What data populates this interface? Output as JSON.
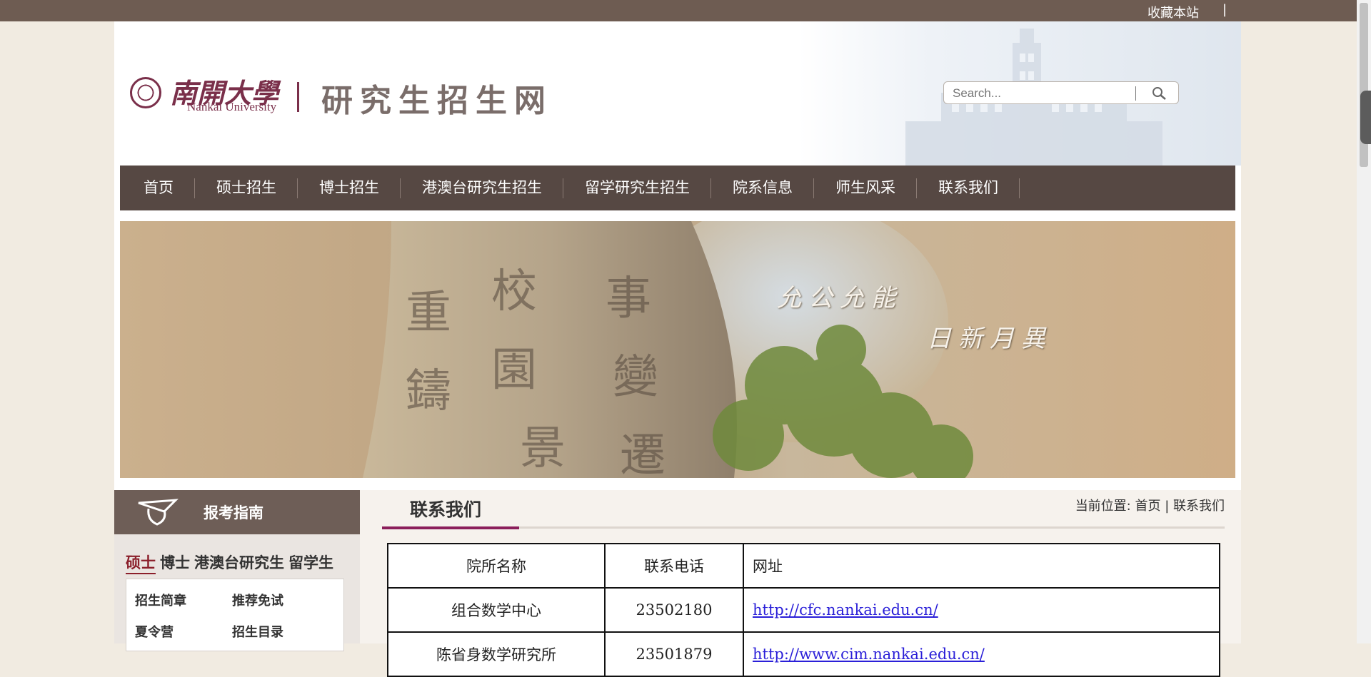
{
  "topbar": {
    "favorite": "收藏本站",
    "separator": "|"
  },
  "logo": {
    "cn": "南開大學",
    "en": "Nankai University"
  },
  "site": {
    "title": "研究生招生网"
  },
  "search": {
    "placeholder": "Search..."
  },
  "nav": {
    "items": [
      "首页",
      "硕士招生",
      "博士招生",
      "港澳台研究生招生",
      "留学研究生招生",
      "院系信息",
      "师生风采",
      "联系我们"
    ]
  },
  "banner": {
    "line1": "允公允能",
    "line2": "日新月異"
  },
  "sidebar": {
    "title": "报考指南",
    "tabs": [
      "硕士",
      "博士",
      "港澳台研究生",
      "留学生"
    ],
    "links": [
      "招生简章",
      "推荐免试",
      "夏令营",
      "招生目录"
    ]
  },
  "main": {
    "title": "联系我们",
    "breadcrumb_prefix": "当前位置: ",
    "breadcrumb_home": "首页",
    "breadcrumb_sep": " | ",
    "breadcrumb_current": "联系我们"
  },
  "table": {
    "headers": [
      "院所名称",
      "联系电话",
      "网址"
    ],
    "rows": [
      {
        "name": "组合数学中心",
        "phone": "23502180",
        "url": "http://cfc.nankai.edu.cn/"
      },
      {
        "name": "陈省身数学研究所",
        "phone": "23501879",
        "url": "http://www.cim.nankai.edu.cn/"
      }
    ]
  },
  "colors": {
    "nav": "#564843",
    "accent": "#8b1f5b",
    "topbar": "#6e5c52"
  }
}
